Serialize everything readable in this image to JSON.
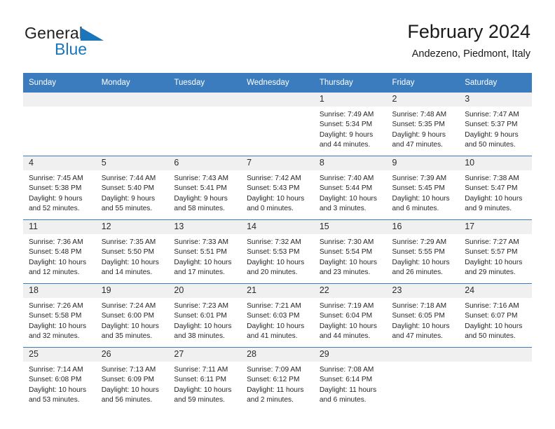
{
  "brand": {
    "name_top": "General",
    "name_bottom": "Blue",
    "triangle_icon": "blue-triangle-logo-icon",
    "color_primary": "#1b75bb",
    "color_text": "#231f20"
  },
  "header": {
    "title": "February 2024",
    "subtitle": "Andezeno, Piedmont, Italy"
  },
  "calendar": {
    "accent_color": "#3a7cbe",
    "daynum_band_color": "#f0f0f0",
    "weekday_headers": [
      "Sunday",
      "Monday",
      "Tuesday",
      "Wednesday",
      "Thursday",
      "Friday",
      "Saturday"
    ],
    "weeks": [
      [
        {
          "day": "",
          "lines": []
        },
        {
          "day": "",
          "lines": []
        },
        {
          "day": "",
          "lines": []
        },
        {
          "day": "",
          "lines": []
        },
        {
          "day": "1",
          "lines": [
            "Sunrise: 7:49 AM",
            "Sunset: 5:34 PM",
            "Daylight: 9 hours",
            "and 44 minutes."
          ]
        },
        {
          "day": "2",
          "lines": [
            "Sunrise: 7:48 AM",
            "Sunset: 5:35 PM",
            "Daylight: 9 hours",
            "and 47 minutes."
          ]
        },
        {
          "day": "3",
          "lines": [
            "Sunrise: 7:47 AM",
            "Sunset: 5:37 PM",
            "Daylight: 9 hours",
            "and 50 minutes."
          ]
        }
      ],
      [
        {
          "day": "4",
          "lines": [
            "Sunrise: 7:45 AM",
            "Sunset: 5:38 PM",
            "Daylight: 9 hours",
            "and 52 minutes."
          ]
        },
        {
          "day": "5",
          "lines": [
            "Sunrise: 7:44 AM",
            "Sunset: 5:40 PM",
            "Daylight: 9 hours",
            "and 55 minutes."
          ]
        },
        {
          "day": "6",
          "lines": [
            "Sunrise: 7:43 AM",
            "Sunset: 5:41 PM",
            "Daylight: 9 hours",
            "and 58 minutes."
          ]
        },
        {
          "day": "7",
          "lines": [
            "Sunrise: 7:42 AM",
            "Sunset: 5:43 PM",
            "Daylight: 10 hours",
            "and 0 minutes."
          ]
        },
        {
          "day": "8",
          "lines": [
            "Sunrise: 7:40 AM",
            "Sunset: 5:44 PM",
            "Daylight: 10 hours",
            "and 3 minutes."
          ]
        },
        {
          "day": "9",
          "lines": [
            "Sunrise: 7:39 AM",
            "Sunset: 5:45 PM",
            "Daylight: 10 hours",
            "and 6 minutes."
          ]
        },
        {
          "day": "10",
          "lines": [
            "Sunrise: 7:38 AM",
            "Sunset: 5:47 PM",
            "Daylight: 10 hours",
            "and 9 minutes."
          ]
        }
      ],
      [
        {
          "day": "11",
          "lines": [
            "Sunrise: 7:36 AM",
            "Sunset: 5:48 PM",
            "Daylight: 10 hours",
            "and 12 minutes."
          ]
        },
        {
          "day": "12",
          "lines": [
            "Sunrise: 7:35 AM",
            "Sunset: 5:50 PM",
            "Daylight: 10 hours",
            "and 14 minutes."
          ]
        },
        {
          "day": "13",
          "lines": [
            "Sunrise: 7:33 AM",
            "Sunset: 5:51 PM",
            "Daylight: 10 hours",
            "and 17 minutes."
          ]
        },
        {
          "day": "14",
          "lines": [
            "Sunrise: 7:32 AM",
            "Sunset: 5:53 PM",
            "Daylight: 10 hours",
            "and 20 minutes."
          ]
        },
        {
          "day": "15",
          "lines": [
            "Sunrise: 7:30 AM",
            "Sunset: 5:54 PM",
            "Daylight: 10 hours",
            "and 23 minutes."
          ]
        },
        {
          "day": "16",
          "lines": [
            "Sunrise: 7:29 AM",
            "Sunset: 5:55 PM",
            "Daylight: 10 hours",
            "and 26 minutes."
          ]
        },
        {
          "day": "17",
          "lines": [
            "Sunrise: 7:27 AM",
            "Sunset: 5:57 PM",
            "Daylight: 10 hours",
            "and 29 minutes."
          ]
        }
      ],
      [
        {
          "day": "18",
          "lines": [
            "Sunrise: 7:26 AM",
            "Sunset: 5:58 PM",
            "Daylight: 10 hours",
            "and 32 minutes."
          ]
        },
        {
          "day": "19",
          "lines": [
            "Sunrise: 7:24 AM",
            "Sunset: 6:00 PM",
            "Daylight: 10 hours",
            "and 35 minutes."
          ]
        },
        {
          "day": "20",
          "lines": [
            "Sunrise: 7:23 AM",
            "Sunset: 6:01 PM",
            "Daylight: 10 hours",
            "and 38 minutes."
          ]
        },
        {
          "day": "21",
          "lines": [
            "Sunrise: 7:21 AM",
            "Sunset: 6:03 PM",
            "Daylight: 10 hours",
            "and 41 minutes."
          ]
        },
        {
          "day": "22",
          "lines": [
            "Sunrise: 7:19 AM",
            "Sunset: 6:04 PM",
            "Daylight: 10 hours",
            "and 44 minutes."
          ]
        },
        {
          "day": "23",
          "lines": [
            "Sunrise: 7:18 AM",
            "Sunset: 6:05 PM",
            "Daylight: 10 hours",
            "and 47 minutes."
          ]
        },
        {
          "day": "24",
          "lines": [
            "Sunrise: 7:16 AM",
            "Sunset: 6:07 PM",
            "Daylight: 10 hours",
            "and 50 minutes."
          ]
        }
      ],
      [
        {
          "day": "25",
          "lines": [
            "Sunrise: 7:14 AM",
            "Sunset: 6:08 PM",
            "Daylight: 10 hours",
            "and 53 minutes."
          ]
        },
        {
          "day": "26",
          "lines": [
            "Sunrise: 7:13 AM",
            "Sunset: 6:09 PM",
            "Daylight: 10 hours",
            "and 56 minutes."
          ]
        },
        {
          "day": "27",
          "lines": [
            "Sunrise: 7:11 AM",
            "Sunset: 6:11 PM",
            "Daylight: 10 hours",
            "and 59 minutes."
          ]
        },
        {
          "day": "28",
          "lines": [
            "Sunrise: 7:09 AM",
            "Sunset: 6:12 PM",
            "Daylight: 11 hours",
            "and 2 minutes."
          ]
        },
        {
          "day": "29",
          "lines": [
            "Sunrise: 7:08 AM",
            "Sunset: 6:14 PM",
            "Daylight: 11 hours",
            "and 6 minutes."
          ]
        },
        {
          "day": "",
          "lines": []
        },
        {
          "day": "",
          "lines": []
        }
      ]
    ]
  }
}
